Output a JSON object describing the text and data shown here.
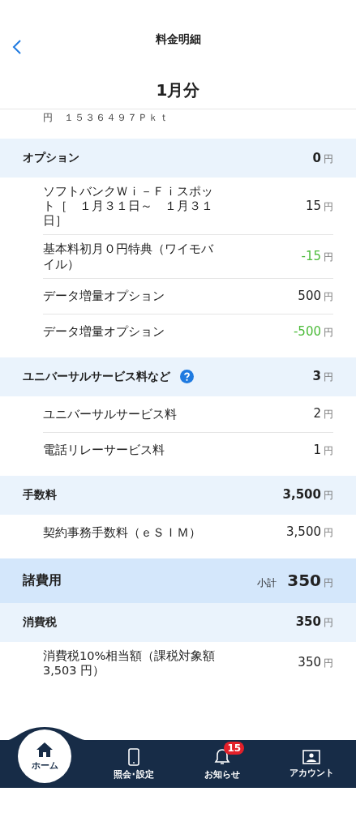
{
  "header": {
    "title": "料金明細",
    "period": "1月分"
  },
  "cut_row": "円　１５３６４９７Ｐｋｔ",
  "sections": [
    {
      "kind": "group",
      "title": "オプション",
      "help": false,
      "amount": "0",
      "unit": "円",
      "items": [
        {
          "label": "ソフトバンクＷｉ－Ｆｉスポット［　１月３１日～　１月３１日］",
          "amount": "15",
          "unit": "円",
          "credit": false
        },
        {
          "label": "基本料初月０円特典（ワイモバイル）",
          "amount": "-15",
          "unit": "円",
          "credit": true
        },
        {
          "label": "データ増量オプション",
          "amount": "500",
          "unit": "円",
          "credit": false
        },
        {
          "label": "データ増量オプション",
          "amount": "-500",
          "unit": "円",
          "credit": true
        }
      ]
    },
    {
      "kind": "group",
      "title": "ユニバーサルサービス料など",
      "help": true,
      "amount": "3",
      "unit": "円",
      "items": [
        {
          "label": "ユニバーサルサービス料",
          "amount": "2",
          "unit": "円",
          "credit": false
        },
        {
          "label": "電話リレーサービス料",
          "amount": "1",
          "unit": "円",
          "credit": false
        }
      ]
    },
    {
      "kind": "group",
      "title": "手数料",
      "help": false,
      "amount": "3,500",
      "unit": "円",
      "items": [
        {
          "label": "契約事務手数料（ｅＳＩＭ）",
          "amount": "3,500",
          "unit": "円",
          "credit": false
        }
      ]
    },
    {
      "kind": "subtotal",
      "title": "諸費用",
      "caption": "小計",
      "amount": "350",
      "unit": "円"
    },
    {
      "kind": "group",
      "title": "消費税",
      "help": false,
      "amount": "350",
      "unit": "円",
      "items": [
        {
          "label": "消費税10%相当額（課税対象額3,503 円）",
          "amount": "350",
          "unit": "円",
          "credit": false
        }
      ]
    }
  ],
  "nav": [
    {
      "kind": "home",
      "label": "ホーム",
      "selected": true
    },
    {
      "kind": "phone",
      "label": "照会･設定",
      "selected": false
    },
    {
      "kind": "bell",
      "label": "お知らせ",
      "selected": false,
      "badge": "15"
    },
    {
      "kind": "account",
      "label": "アカウント",
      "selected": false
    }
  ]
}
